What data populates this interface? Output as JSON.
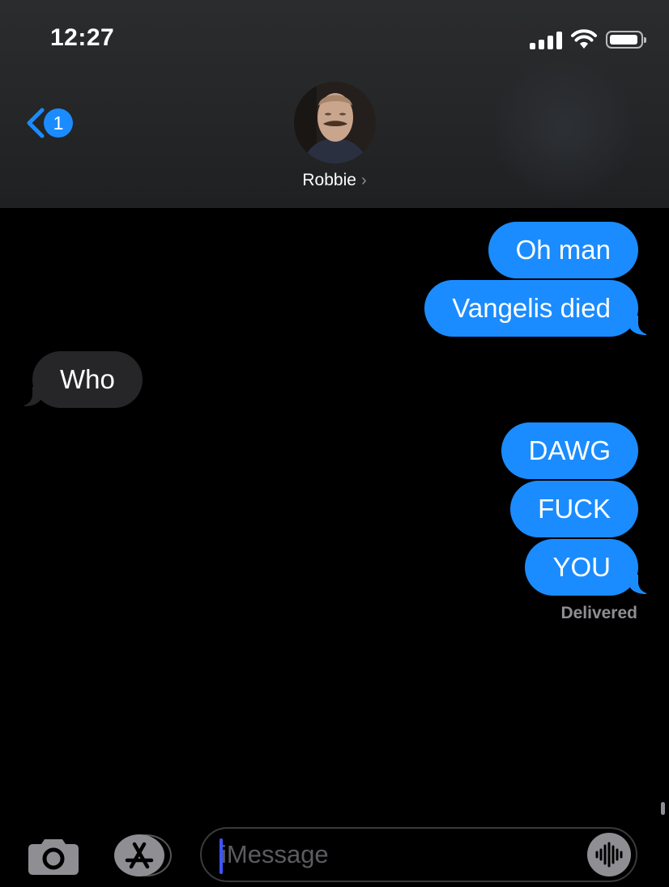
{
  "status_bar": {
    "time": "12:27",
    "icons": [
      "signal-icon",
      "wifi-icon",
      "battery-icon"
    ]
  },
  "nav": {
    "back_icon": "chevron-left-icon",
    "unread_badge": "1",
    "contact_name": "Robbie",
    "contact_chevron": "›"
  },
  "messages": [
    {
      "direction": "outgoing",
      "text": "Oh man"
    },
    {
      "direction": "outgoing",
      "text": "Vangelis died"
    },
    {
      "direction": "incoming",
      "text": "Who"
    },
    {
      "direction": "outgoing",
      "text": "DAWG"
    },
    {
      "direction": "outgoing",
      "text": "FUCK"
    },
    {
      "direction": "outgoing",
      "text": "YOU"
    }
  ],
  "delivery_status": "Delivered",
  "compose": {
    "camera_icon": "camera-icon",
    "apps_icon": "app-store-icon",
    "placeholder": "iMessage",
    "audio_icon": "audio-waveform-icon"
  },
  "colors": {
    "outgoing_bubble": "#1a8cff",
    "incoming_bubble": "#262628",
    "background": "#000000"
  }
}
